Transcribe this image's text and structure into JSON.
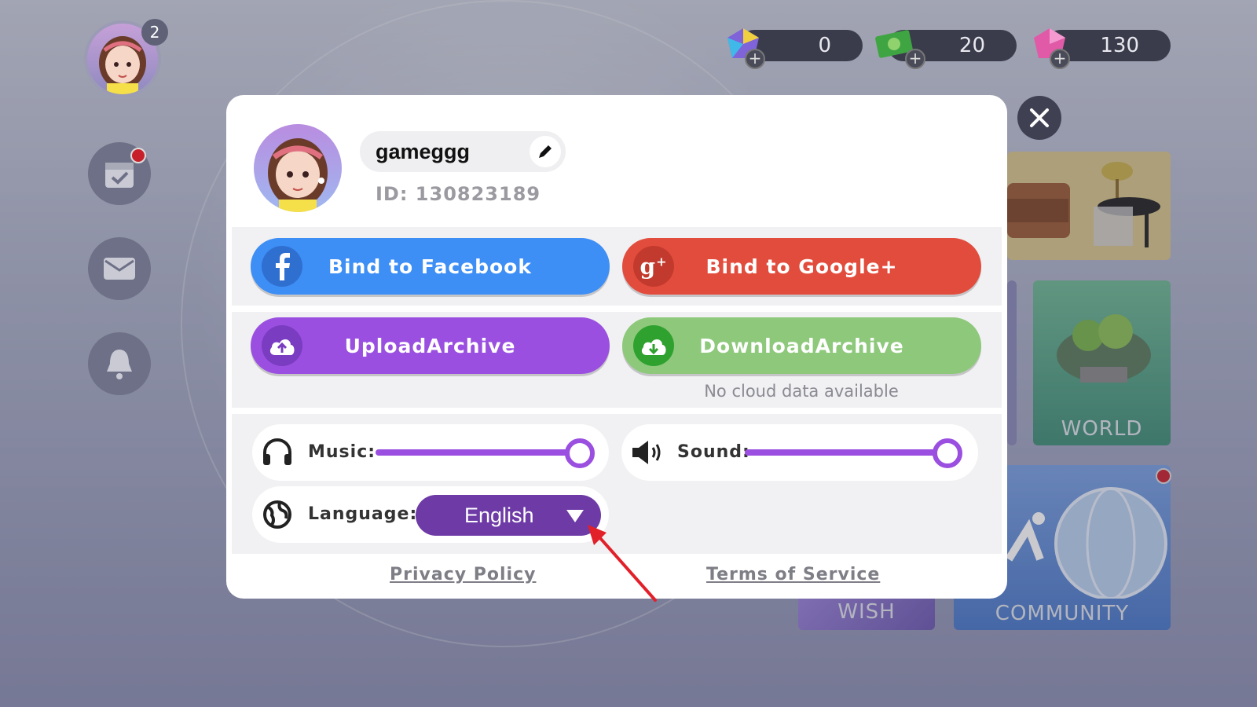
{
  "hud": {
    "notification_count": "2",
    "currencies": [
      {
        "icon": "rainbow-gem-icon",
        "value": "0"
      },
      {
        "icon": "cash-icon",
        "value": "20"
      },
      {
        "icon": "pink-gem-icon",
        "value": "130"
      }
    ]
  },
  "tiles": {
    "world": "WORLD",
    "wish": "WISH",
    "community": "COMMUNITY"
  },
  "profile": {
    "username": "gameggg",
    "id_text": "ID: 130823189"
  },
  "buttons": {
    "facebook": "Bind to Facebook",
    "google": "Bind to Google+",
    "upload": "UploadArchive",
    "download": "DownloadArchive"
  },
  "cloud_status": "No cloud data available",
  "settings": {
    "music_label": "Music:",
    "music_level": 1.0,
    "sound_label": "Sound:",
    "sound_level": 1.0,
    "language_label": "Language:",
    "language_value": "English"
  },
  "links": {
    "privacy": "Privacy Policy",
    "terms": "Terms of Service"
  },
  "colors": {
    "facebook": "#3d8ef5",
    "google": "#e24c3d",
    "upload": "#9a4fe0",
    "download": "#8dc87b",
    "slider": "#9a4fe0",
    "language": "#6d3aa6"
  }
}
